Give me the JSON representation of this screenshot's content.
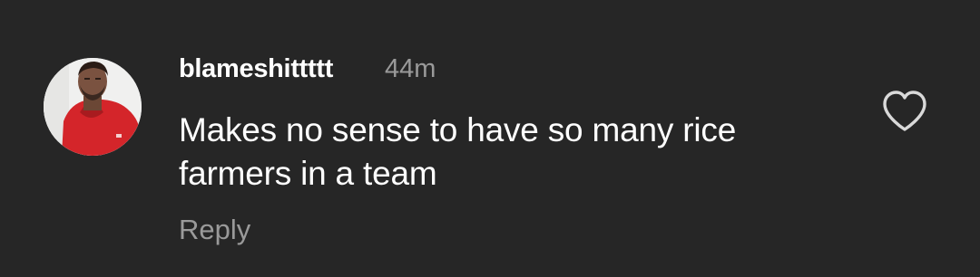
{
  "comment": {
    "username": "blameshittttt",
    "time": "44m",
    "text": "Makes no sense to have so many rice farmers in a team",
    "reply_label": "Reply",
    "like_icon": "heart-outline-icon"
  },
  "colors": {
    "background": "#262626",
    "primary_text": "#ffffff",
    "secondary_text": "#9a9a9a"
  }
}
